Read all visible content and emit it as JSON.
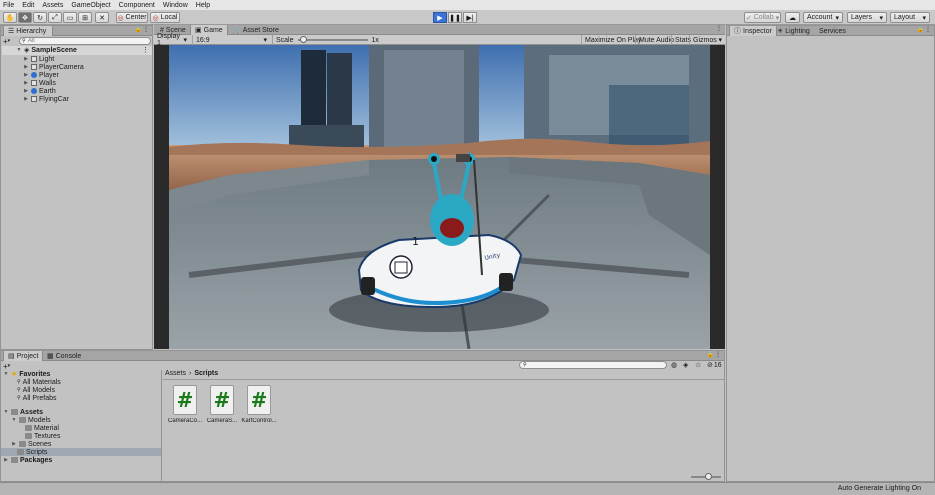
{
  "menu": [
    "File",
    "Edit",
    "Assets",
    "GameObject",
    "Component",
    "Window",
    "Help"
  ],
  "toolbar": {
    "pivot": "Center",
    "space": "Local",
    "collab": "Collab",
    "account": "Account",
    "layers": "Layers",
    "layout": "Layout"
  },
  "hierarchy": {
    "tab": "Hierarchy",
    "add": "+",
    "search_placeholder": "All",
    "scene": "SampleScene",
    "items": [
      "Light",
      "PlayerCamera",
      "Player",
      "Walls",
      "Earth",
      "FlyingCar"
    ]
  },
  "center_tabs": [
    "Scene",
    "Game",
    "Asset Store"
  ],
  "game_bar": {
    "display": "Display 1",
    "aspect": "16:9",
    "scale_label": "Scale",
    "scale_value": "1x",
    "maximize": "Maximize On Play",
    "mute": "Mute Audio",
    "stats": "Stats",
    "gizmos": "Gizmos"
  },
  "right_tabs": [
    "Inspector",
    "Lighting",
    "Services"
  ],
  "bottom_tabs": [
    "Project",
    "Console"
  ],
  "project": {
    "favorites_label": "Favorites",
    "favorites": [
      "All Materials",
      "All Models",
      "All Prefabs"
    ],
    "assets_label": "Assets",
    "assets_tree": [
      {
        "label": "Models",
        "level": 1
      },
      {
        "label": "Material",
        "level": 2
      },
      {
        "label": "Textures",
        "level": 2
      },
      {
        "label": "Scenes",
        "level": 1
      },
      {
        "label": "Scripts",
        "level": 1
      }
    ],
    "packages_label": "Packages",
    "breadcrumb": [
      "Assets",
      "Scripts"
    ],
    "hidden_count": "16",
    "files": [
      "CameraCo...",
      "CameraS...",
      "KartControl..."
    ]
  },
  "game_scene": {
    "kart_number": "1",
    "kart_side_text": "Unity"
  },
  "status": "Auto Generate Lighting On",
  "colors": {
    "play_active": "#3c74d6",
    "panel_bg": "#c2c2c2",
    "sky_top": "#3f6fb0",
    "ground": "#b98a6c"
  }
}
